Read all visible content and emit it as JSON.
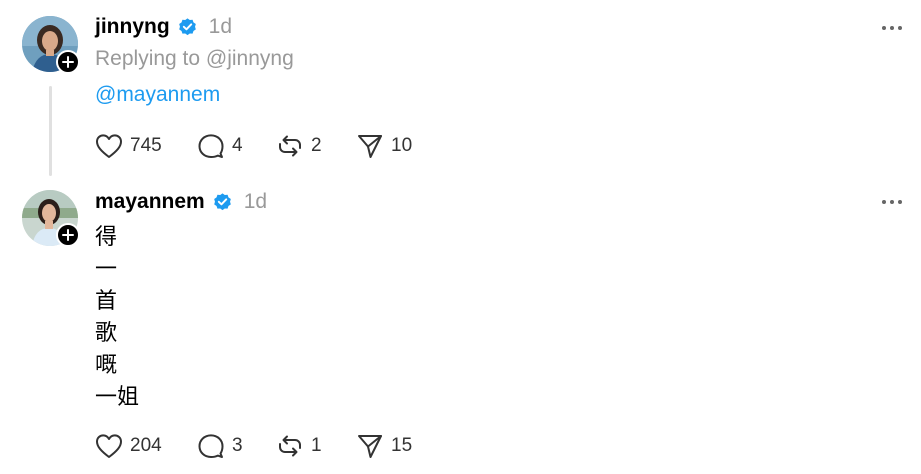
{
  "posts": [
    {
      "username": "jinnyng",
      "time": "1d",
      "replying_to": "Replying to @jinnyng",
      "mention": "@mayannem",
      "stats": {
        "likes": "745",
        "comments": "4",
        "reposts": "2",
        "shares": "10"
      }
    },
    {
      "username": "mayannem",
      "time": "1d",
      "lines": [
        "得",
        "一",
        "首",
        "歌",
        "嘅",
        "一姐"
      ],
      "stats": {
        "likes": "204",
        "comments": "3",
        "reposts": "1",
        "shares": "15"
      }
    }
  ],
  "icons": {
    "verified": "verified-badge-icon",
    "follow": "plus-icon",
    "more": "more-horizontal-icon",
    "like": "heart-icon",
    "comment": "comment-bubble-icon",
    "repost": "repost-icon",
    "share": "send-icon"
  },
  "colors": {
    "verified": "#1d9bf0",
    "mention": "#1d9bf0",
    "muted": "#999999"
  }
}
